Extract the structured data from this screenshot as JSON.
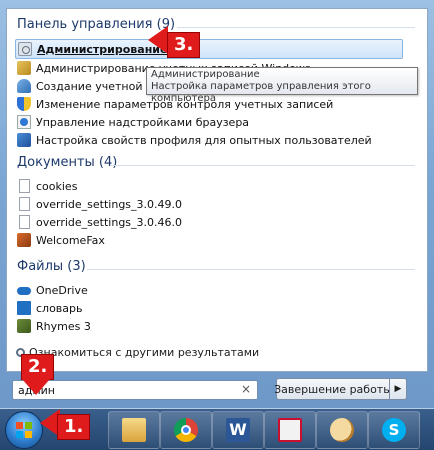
{
  "groups": {
    "control_panel": {
      "title": "Панель управления (9)",
      "items": [
        {
          "label": "Администрирование",
          "icon": "admin-tools-icon"
        },
        {
          "label": "Администрирование учетных записей Windows",
          "icon": "user-accounts-icon"
        },
        {
          "label": "Создание учетной записи",
          "icon": "create-account-icon"
        },
        {
          "label": "Изменение параметров контроля учетных записей",
          "icon": "uac-shield-icon"
        },
        {
          "label": "Управление надстройками браузера",
          "icon": "browser-addons-icon"
        },
        {
          "label": "Настройка свойств профиля для опытных пользователей",
          "icon": "system-icon"
        }
      ]
    },
    "documents": {
      "title": "Документы (4)",
      "items": [
        {
          "label": "cookies",
          "icon": "document-icon"
        },
        {
          "label": "override_settings_3.0.49.0",
          "icon": "document-icon"
        },
        {
          "label": "override_settings_3.0.46.0",
          "icon": "document-icon"
        },
        {
          "label": "WelcomeFax",
          "icon": "fax-icon"
        }
      ]
    },
    "files": {
      "title": "Файлы (3)",
      "items": [
        {
          "label": "OneDrive",
          "icon": "onedrive-icon"
        },
        {
          "label": "словарь",
          "icon": "dictionary-icon"
        },
        {
          "label": "Rhymes 3",
          "icon": "package-icon"
        }
      ]
    }
  },
  "tooltip": {
    "title": "Администрирование",
    "text": "Настройка параметров управления этого компьютера"
  },
  "more_results": "Ознакомиться с другими результатами",
  "search": {
    "value": "админ",
    "clear": "×"
  },
  "shutdown": {
    "label": "Завершение работы",
    "arrow": "▶"
  },
  "taskbar": {
    "apps": [
      "windows-explorer-icon",
      "chrome-icon",
      "word-icon",
      "acrobat-icon",
      "paint-icon",
      "skype-icon"
    ],
    "word_glyph": "W",
    "skype_glyph": "S"
  },
  "annotations": {
    "step1": "1.",
    "step2": "2.",
    "step3": "3."
  }
}
